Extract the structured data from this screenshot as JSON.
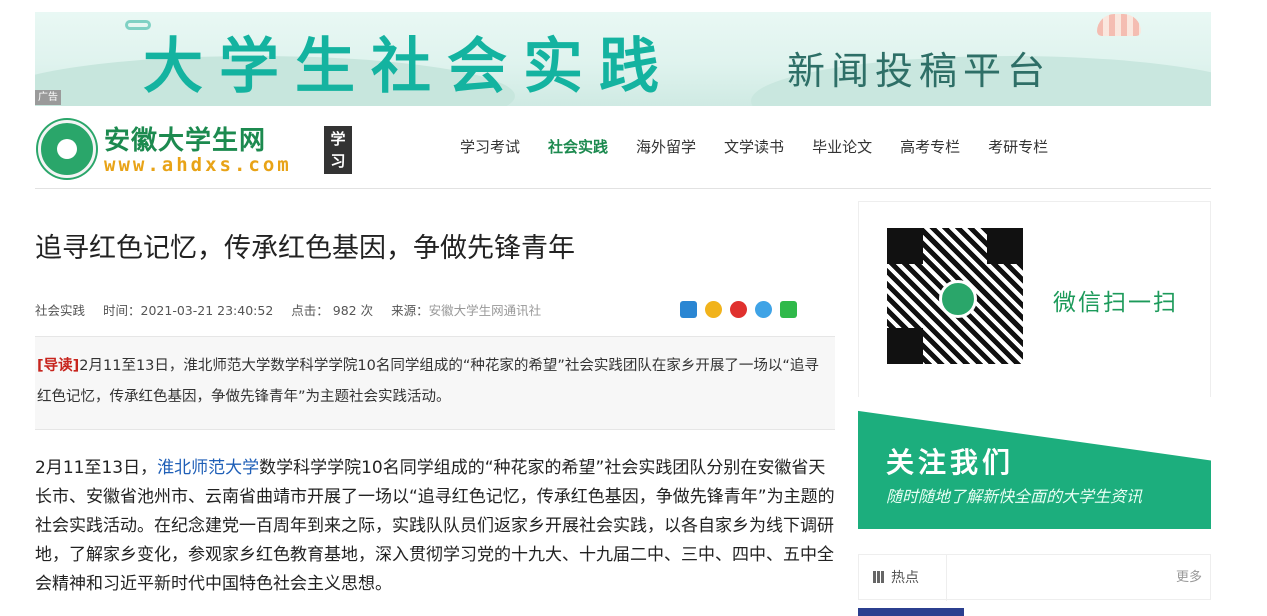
{
  "banner": {
    "headline": "大学生社会实践",
    "subheadline": "新闻投稿平台",
    "ad_label": "广告"
  },
  "logo": {
    "name": "安徽大学生网",
    "url": "www.ahdxs.com",
    "tag": "学习"
  },
  "nav": {
    "items": [
      "学习考试",
      "社会实践",
      "海外留学",
      "文学读书",
      "毕业论文",
      "高考专栏",
      "考研专栏"
    ],
    "active": "社会实践"
  },
  "article": {
    "title": "追寻红色记忆，传承红色基因，争做先锋青年",
    "category": "社会实践",
    "time": "时间：2021-03-21 23:40:52",
    "clicks": "点击：  982 次",
    "source_label": "来源：",
    "source": "安徽大学生网通讯社",
    "lead_tag": "[导读]",
    "lead": "2月11至13日，淮北师范大学数学科学学院10名同学组成的“种花家的希望”社会实践团队在家乡开展了一场以“追寻红色记忆，传承红色基因，争做先锋青年”为主题社会实践活动。",
    "body_pre": "2月11至13日，",
    "body_link": "淮北师范大学",
    "body_post": "数学科学学院10名同学组成的“种花家的希望”社会实践团队分别在安徽省天长市、安徽省池州市、云南省曲靖市开展了一场以“追寻红色记忆，传承红色基因，争做先锋青年”为主题的社会实践活动。在纪念建党一百周年到来之际，实践队队员们返家乡开展社会实践，以各自家乡为线下调研地，了解家乡变化，参观家乡红色教育基地，深入贯彻学习党的十九大、十九届二中、三中、四中、五中全会精神和习近平新时代中国特色社会主义思想。"
  },
  "share_icons": [
    "qzone-icon",
    "favorite-star-icon",
    "weibo-icon",
    "pinterest-icon",
    "wechat-icon"
  ],
  "sidebar": {
    "qr_text": "微信扫一扫",
    "follow_title": "关注我们",
    "follow_sub": "随时随地了解新快全面的大学生资讯",
    "hot_tab": "热点",
    "more": "更多"
  }
}
